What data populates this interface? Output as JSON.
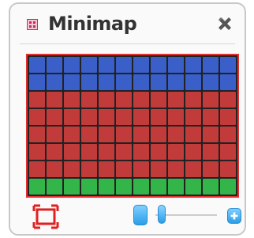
{
  "window": {
    "title": "Minimap",
    "app_icon": "map-icon",
    "close_icon": "close-x-icon"
  },
  "minimap": {
    "columns": 12,
    "rows": 8,
    "row_colors": [
      "#3a5fc8",
      "#3a5fc8",
      "#c23b3b",
      "#c23b3b",
      "#c23b3b",
      "#c23b3b",
      "#c23b3b",
      "#33b54a"
    ],
    "viewport_border_color": "#e03030"
  },
  "controls": {
    "fit_icon": "fit-to-view-icon",
    "zoom_out_icon": "minus-icon",
    "zoom_in_icon": "plus-icon",
    "zoom_level": 0.05,
    "accent_color": "#2a9ee8"
  }
}
